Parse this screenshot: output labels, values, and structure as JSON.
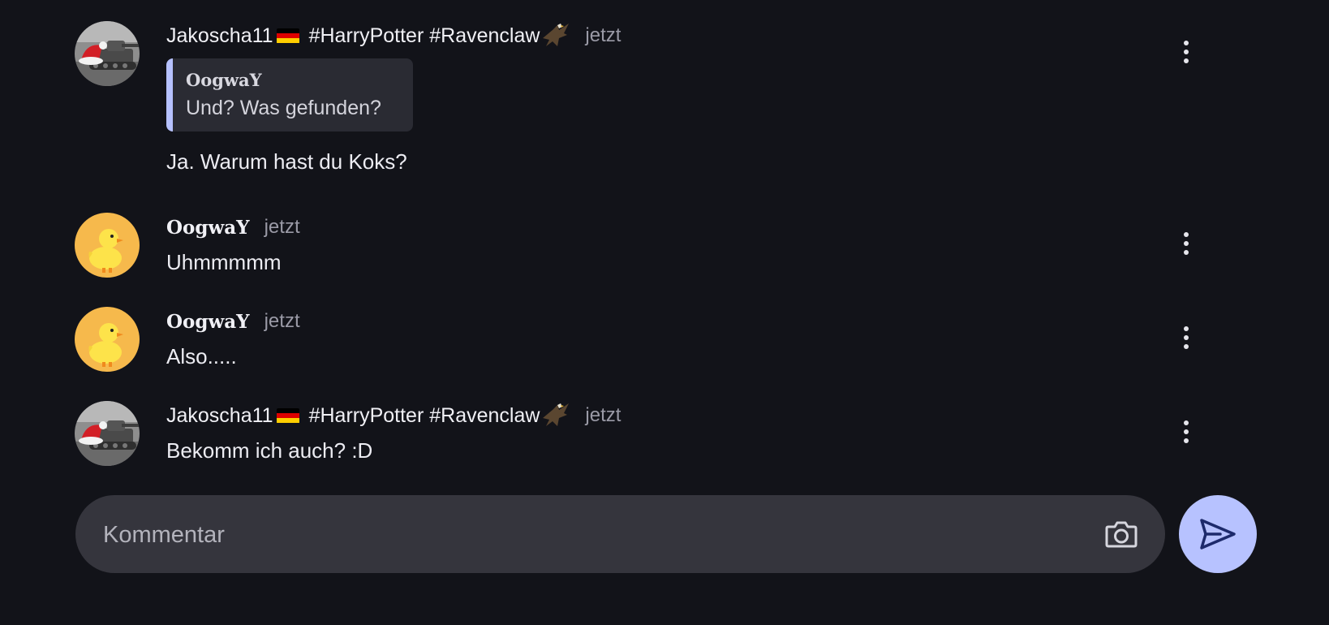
{
  "colors": {
    "background": "#121319",
    "quote_accent": "#b6c1ff",
    "send_button": "#b7c2ff",
    "composer_bg": "#35353d",
    "flag_black": "#000000",
    "flag_red": "#dd0000",
    "flag_gold": "#ffce00"
  },
  "messages": [
    {
      "author": "Jakoscha11",
      "author_flag": "german-flag-icon",
      "tags": "#HarryPotter #Ravenclaw",
      "tag_icon": "eagle-icon",
      "time": "jetzt",
      "avatar": "santa-hat-tank-avatar",
      "quote": {
        "author": "OogwaY",
        "text": "Und? Was gefunden?"
      },
      "text": "Ja. Warum hast du Koks?"
    },
    {
      "author": "OogwaY",
      "time": "jetzt",
      "avatar": "duck-avatar",
      "text": "Uhmmmmm"
    },
    {
      "author": "OogwaY",
      "time": "jetzt",
      "avatar": "duck-avatar",
      "text": "Also....."
    },
    {
      "author": "Jakoscha11",
      "author_flag": "german-flag-icon",
      "tags": "#HarryPotter #Ravenclaw",
      "tag_icon": "eagle-icon",
      "time": "jetzt",
      "avatar": "santa-hat-tank-avatar",
      "text": "Bekomm ich auch? :D"
    }
  ],
  "composer": {
    "placeholder": "Kommentar",
    "camera_icon": "camera-icon",
    "send_icon": "send-icon"
  }
}
